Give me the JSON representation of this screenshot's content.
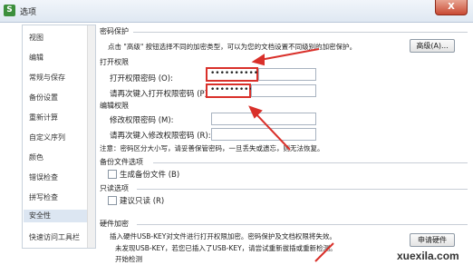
{
  "window": {
    "title": "选项",
    "close_label": "X"
  },
  "sidebar": {
    "items": [
      {
        "label": "视图"
      },
      {
        "label": "编辑"
      },
      {
        "label": "常规与保存"
      },
      {
        "label": "备份设置"
      },
      {
        "label": "重新计算"
      },
      {
        "label": "自定义序列"
      },
      {
        "label": "颜色"
      },
      {
        "label": "错误检查"
      },
      {
        "label": "拼写检查"
      },
      {
        "label": "安全性"
      },
      {
        "label": "快速访问工具栏"
      }
    ],
    "active_index": 9
  },
  "password_protection": {
    "heading": "密码保护",
    "description": "点击 \"高级\" 按钮选择不同的加密类型，可以为您的文档设置不同级别的加密保护。",
    "advanced_button": "高级(A)..."
  },
  "open_permission": {
    "heading": "打开权限",
    "password_label": "打开权限密码 (O):",
    "password_value": "••••••••••",
    "confirm_label": "请再次键入打开权限密码 (P):",
    "confirm_value": "•••••••••"
  },
  "edit_permission": {
    "heading": "编辑权限",
    "password_label": "修改权限密码 (M):",
    "password_value": "",
    "confirm_label": "请再次键入修改权限密码 (R):",
    "confirm_value": ""
  },
  "note": "注意：密码区分大小写，请妥善保管密码，一旦丢失或遗忘，则无法恢复。",
  "backup": {
    "heading": "备份文件选项",
    "checkbox_label": "生成备份文件 (B)"
  },
  "readonly": {
    "heading": "只读选项",
    "checkbox_label": "建议只读 (R)"
  },
  "hardware": {
    "heading": "硬件加密",
    "line1": "插入硬件USB-KEY对文件进行打开权限加密。密码保护及文档权限将失效。",
    "line2": "未发现USB-KEY，若您已插入了USB-KEY，请尝试重新拔插或重新检测。",
    "line3": "开始检测",
    "apply_button": "申请硬件"
  },
  "watermark": "xuexila.com",
  "colors": {
    "highlight": "#d9302a",
    "active_item": "#dce6f2"
  }
}
